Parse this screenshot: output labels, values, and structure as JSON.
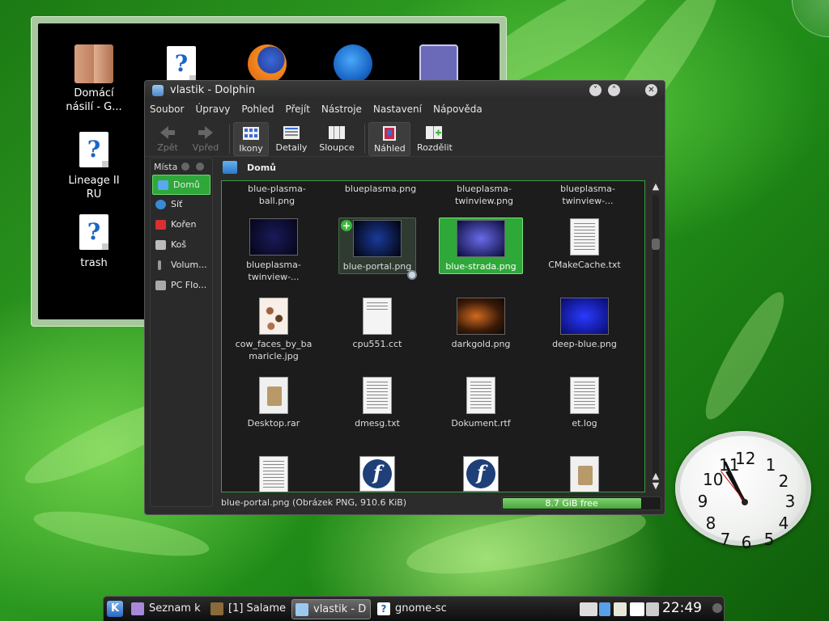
{
  "desktop": {
    "icons": [
      {
        "label": "Domácí\nnásilí - G...",
        "icon": "faces-image-icon"
      },
      {
        "label": "",
        "icon": "unknown-file-icon"
      },
      {
        "label": "",
        "icon": "firefox-icon"
      },
      {
        "label": "",
        "icon": "network-globe-icon"
      },
      {
        "label": "",
        "icon": "presentation-icon"
      },
      {
        "label": "Lineage II\nRU",
        "icon": "unknown-file-icon"
      },
      {
        "label": "trash",
        "icon": "unknown-file-icon"
      }
    ]
  },
  "window": {
    "title": "vlastik - Dolphin",
    "menu": [
      "Soubor",
      "Úpravy",
      "Pohled",
      "Přejít",
      "Nástroje",
      "Nastavení",
      "Nápověda"
    ],
    "toolbar": {
      "back": "Zpět",
      "forward": "Vpřed",
      "icons": "Ikony",
      "details": "Detaily",
      "columns": "Sloupce",
      "preview": "Náhled",
      "split": "Rozdělit"
    },
    "places": {
      "header": "Místa",
      "items": [
        {
          "label": "Domů",
          "color": "#5aa8f0"
        },
        {
          "label": "Síť",
          "color": "#3a88d8"
        },
        {
          "label": "Kořen",
          "color": "#d83030"
        },
        {
          "label": "Koš",
          "color": "#bbbbbb"
        },
        {
          "label": "Volum...",
          "color": "#999999"
        },
        {
          "label": "PC Flo...",
          "color": "#aaaaaa"
        }
      ]
    },
    "location": "Domů",
    "files": [
      {
        "name": "blue-plasma-\nball.png"
      },
      {
        "name": "blueplasma.png"
      },
      {
        "name": "blueplasma-\ntwinview.png"
      },
      {
        "name": "blueplasma-\ntwinview-..."
      },
      {
        "name": "blueplasma-\ntwinview-..."
      },
      {
        "name": "blue-portal.png"
      },
      {
        "name": "blue-strada.png"
      },
      {
        "name": "CMakeCache.txt"
      },
      {
        "name": "cow_faces_by_ba\nmaricle.jpg"
      },
      {
        "name": "cpu551.cct"
      },
      {
        "name": "darkgold.png"
      },
      {
        "name": "deep-blue.png"
      },
      {
        "name": "Desktop.rar"
      },
      {
        "name": "dmesg.txt"
      },
      {
        "name": "Dokument.rtf"
      },
      {
        "name": "et.log"
      }
    ],
    "status": "blue-portal.png (Obrázek PNG, 910.6 KiB)",
    "free_space": "8.7 GiB free",
    "used_fraction": 0.87
  },
  "clock": {
    "numbers": [
      "12",
      "1",
      "2",
      "3",
      "4",
      "5",
      "6",
      "7",
      "8",
      "9",
      "10",
      "11"
    ]
  },
  "taskbar": {
    "tasks": [
      {
        "label": "Seznam k"
      },
      {
        "label": "[1] Salame"
      },
      {
        "label": "vlastik - D"
      },
      {
        "label": "gnome-sc"
      }
    ],
    "time": "22:49"
  }
}
